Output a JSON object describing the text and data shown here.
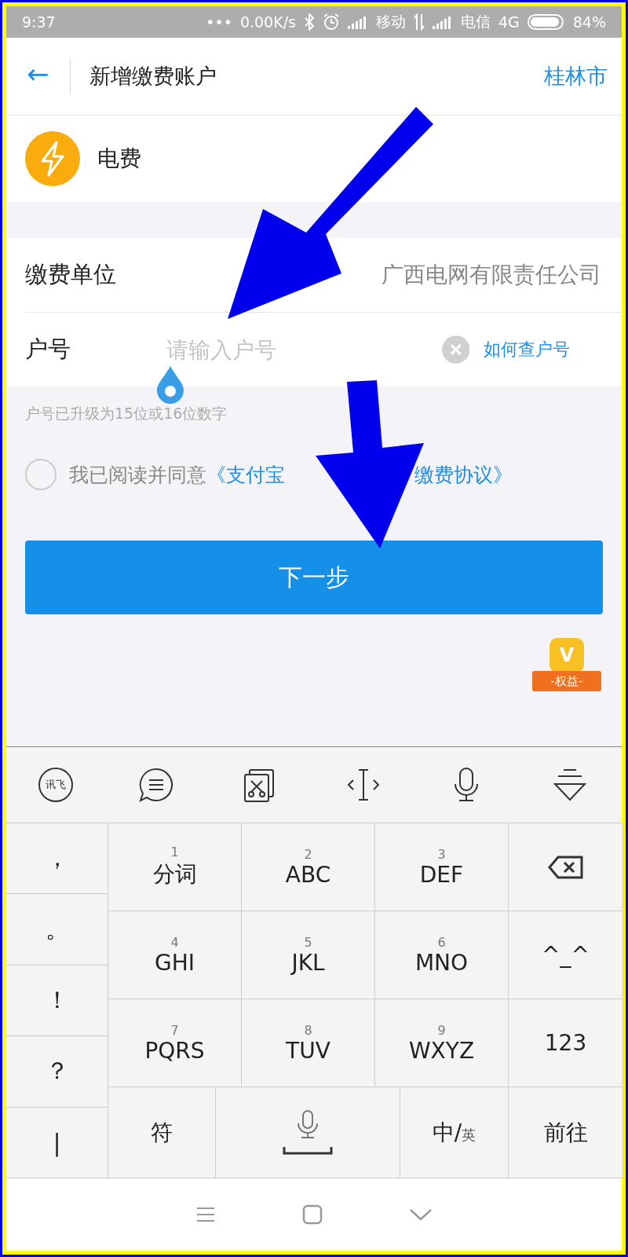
{
  "status_bar": {
    "time": "9:37",
    "dots": "•••",
    "speed": "0.00K/s",
    "carrier_1": "移动",
    "carrier_2": "电信",
    "network": "4G",
    "battery": "84%"
  },
  "header": {
    "back": "←",
    "title": "新增缴费账户",
    "city": "桂林市"
  },
  "service": {
    "name": "电费"
  },
  "form": {
    "rows": [
      {
        "kind": "value",
        "label": "缴费单位",
        "value": "广西电网有限责任公司"
      },
      {
        "kind": "input",
        "label": "户号",
        "placeholder": "请输入户号",
        "help_link": "如何查户号"
      }
    ],
    "hint": "户号已升级为15位或16位数字"
  },
  "agreement": {
    "checked": false,
    "text": "我已阅读并同意",
    "link_parts": [
      "《支付宝",
      "缴费协议》"
    ]
  },
  "next_button": "下一步",
  "badge": {
    "mark": "V",
    "label": "-权益-"
  },
  "keyboard": {
    "toolbar_logo": "讯飞",
    "left_keys": [
      "，",
      "。",
      "！",
      "？",
      "|"
    ],
    "keys": [
      {
        "kind": "letters",
        "number": "1",
        "label": "分词"
      },
      {
        "kind": "letters",
        "number": "2",
        "label": "ABC"
      },
      {
        "kind": "letters",
        "number": "3",
        "label": "DEF"
      },
      {
        "kind": "backspace"
      },
      {
        "kind": "letters",
        "number": "4",
        "label": "GHI"
      },
      {
        "kind": "letters",
        "number": "5",
        "label": "JKL"
      },
      {
        "kind": "letters",
        "number": "6",
        "label": "MNO"
      },
      {
        "kind": "plain",
        "label": "^_^"
      },
      {
        "kind": "letters",
        "number": "7",
        "label": "PQRS"
      },
      {
        "kind": "letters",
        "number": "8",
        "label": "TUV"
      },
      {
        "kind": "letters",
        "number": "9",
        "label": "WXYZ"
      },
      {
        "kind": "plain",
        "label": "123"
      }
    ],
    "bottom_keys": [
      {
        "kind": "plain",
        "label": "符"
      },
      {
        "kind": "space"
      },
      {
        "kind": "lang",
        "label": "中/",
        "sub": "英"
      },
      {
        "kind": "plain",
        "label": "前往"
      }
    ]
  }
}
